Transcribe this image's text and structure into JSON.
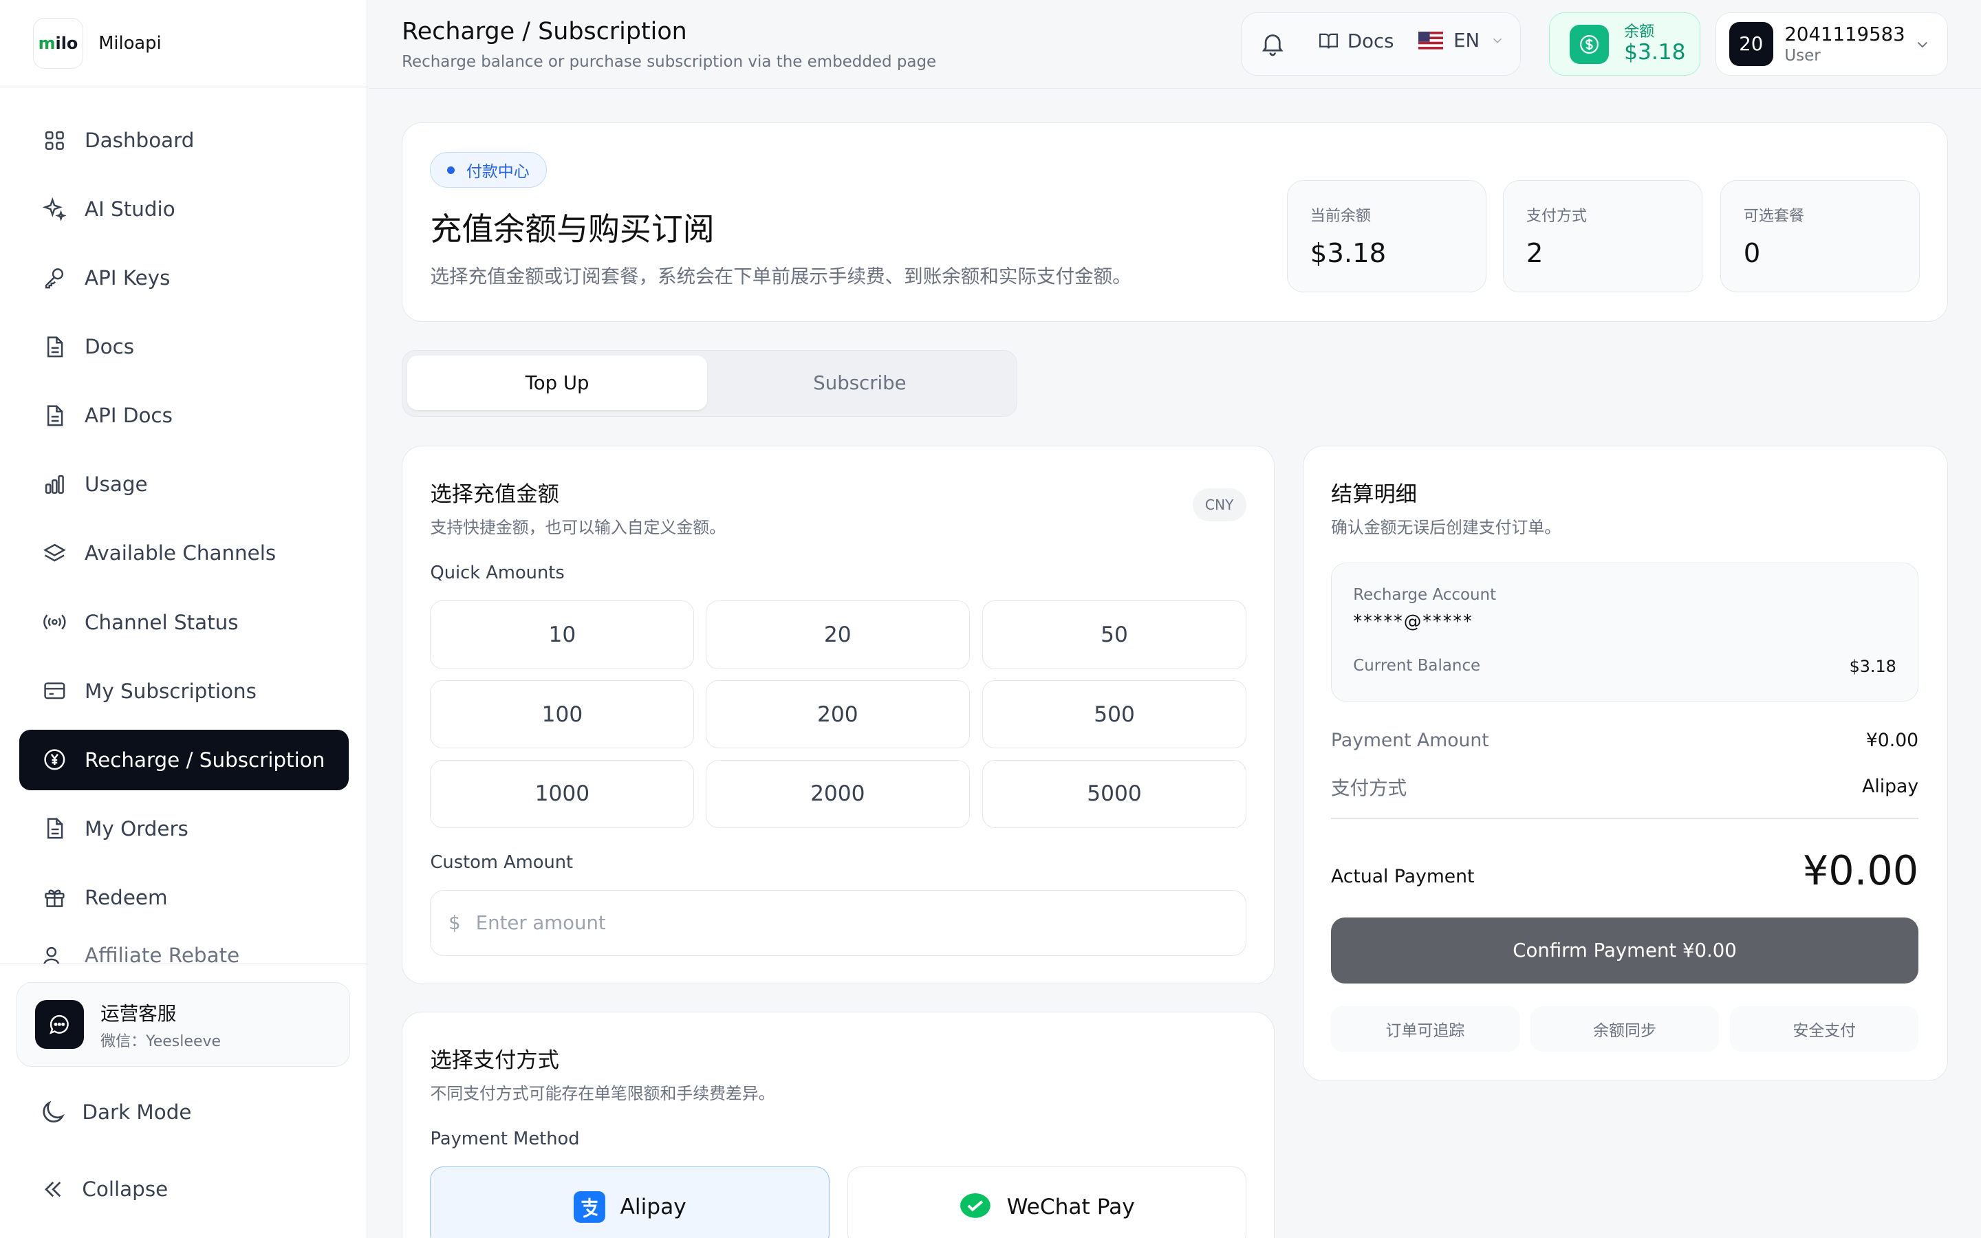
{
  "brand": {
    "logo_text": "milo",
    "name": "Miloapi"
  },
  "sidebar": {
    "items": [
      {
        "label": "Dashboard",
        "icon": "grid-icon"
      },
      {
        "label": "AI Studio",
        "icon": "sparkles-icon"
      },
      {
        "label": "API Keys",
        "icon": "key-icon"
      },
      {
        "label": "Docs",
        "icon": "document-icon"
      },
      {
        "label": "API Docs",
        "icon": "document-icon"
      },
      {
        "label": "Usage",
        "icon": "bar-chart-icon"
      },
      {
        "label": "Available Channels",
        "icon": "layers-icon"
      },
      {
        "label": "Channel Status",
        "icon": "broadcast-icon"
      },
      {
        "label": "My Subscriptions",
        "icon": "credit-card-icon"
      },
      {
        "label": "Recharge / Subscription",
        "icon": "yen-circle-icon",
        "active": true
      },
      {
        "label": "My Orders",
        "icon": "document-icon"
      },
      {
        "label": "Redeem",
        "icon": "gift-icon"
      },
      {
        "label": "Affiliate Rebate",
        "icon": "users-icon"
      }
    ],
    "support": {
      "title": "运营客服",
      "subtitle": "微信：Yeesleeve"
    },
    "dark_mode": "Dark Mode",
    "collapse": "Collapse"
  },
  "header": {
    "title": "Recharge / Subscription",
    "subtitle": "Recharge balance or purchase subscription via the embedded page",
    "docs": "Docs",
    "lang": "EN",
    "balance_label": "余额",
    "balance_value": "$3.18",
    "avatar": "20",
    "username": "2041119583",
    "role": "User"
  },
  "hero": {
    "chip": "付款中心",
    "title": "充值余额与购买订阅",
    "subtitle": "选择充值金额或订阅套餐，系统会在下单前展示手续费、到账余额和实际支付金额。",
    "stats": [
      {
        "label": "当前余额",
        "value": "$3.18"
      },
      {
        "label": "支付方式",
        "value": "2"
      },
      {
        "label": "可选套餐",
        "value": "0"
      }
    ]
  },
  "tabs": {
    "top_up": "Top Up",
    "subscribe": "Subscribe"
  },
  "amount_card": {
    "title": "选择充值金额",
    "subtitle": "支持快捷金额，也可以输入自定义金额。",
    "currency": "CNY",
    "quick_label": "Quick Amounts",
    "amounts": [
      "10",
      "20",
      "50",
      "100",
      "200",
      "500",
      "1000",
      "2000",
      "5000"
    ],
    "custom_label": "Custom Amount",
    "currency_symbol": "$",
    "placeholder": "Enter amount",
    "value": ""
  },
  "payment_card": {
    "title": "选择支付方式",
    "subtitle": "不同支付方式可能存在单笔限额和手续费差异。",
    "label": "Payment Method",
    "methods": [
      "Alipay",
      "WeChat Pay"
    ],
    "selected": "Alipay"
  },
  "summary": {
    "title": "结算明细",
    "subtitle": "确认金额无误后创建支付订单。",
    "account_label": "Recharge Account",
    "account_value": "*****@*****",
    "balance_label": "Current Balance",
    "balance_value": "$3.18",
    "payment_amount_label": "Payment Amount",
    "payment_amount_value": "¥0.00",
    "method_label": "支付方式",
    "method_value": "Alipay",
    "actual_label": "Actual Payment",
    "actual_value": "¥0.00",
    "confirm": "Confirm Payment ¥0.00",
    "tags": [
      "订单可追踪",
      "余额同步",
      "安全支付"
    ]
  },
  "colors": {
    "accent": "#0b0f19",
    "success": "#10b981",
    "info": "#2563eb",
    "alipay": "#1677ff",
    "wechat": "#07c160"
  }
}
